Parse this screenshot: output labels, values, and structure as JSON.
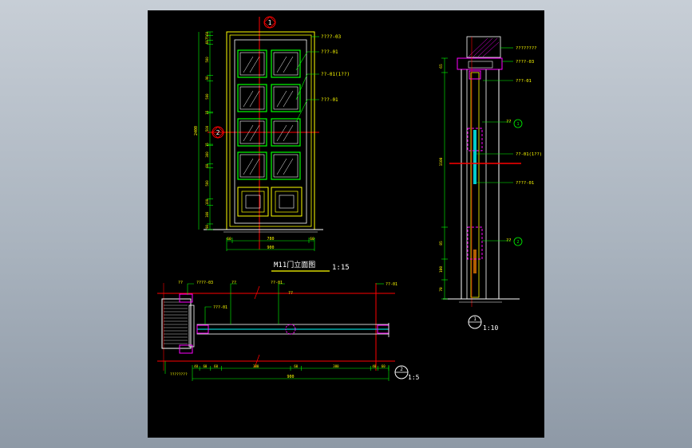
{
  "elevation": {
    "title": "M11门立面图",
    "scale": "1:15",
    "top_marker": "1",
    "side_marker": "2",
    "callouts": [
      "????-03",
      "???-01",
      "??-01(1??)",
      "???-01"
    ],
    "dims_left": [
      "60",
      "75",
      "60",
      "500",
      "90",
      "500",
      "15",
      "500",
      "15",
      "300",
      "60",
      "500",
      "100",
      "300",
      "90"
    ],
    "dim_total_left": "2400",
    "dims_bottom": [
      "60",
      "780",
      "60"
    ],
    "dim_total_bottom": "900"
  },
  "section_v": {
    "marker": "1",
    "scale": "1:10",
    "callouts": [
      "????????",
      "????-03",
      "???-01",
      "??",
      "??-01(1??)",
      "????-01",
      "??"
    ],
    "markers": [
      "1",
      "2"
    ],
    "dims_left": [
      "65",
      "1100",
      "85",
      "100",
      "70"
    ]
  },
  "section_h": {
    "marker": "2",
    "scale": "1:5",
    "callouts": [
      "??",
      "????-03",
      "??",
      "??-01",
      "??",
      "??-01",
      "???-01"
    ],
    "dims_bottom": [
      "40",
      "60",
      "60",
      "380",
      "60",
      "380",
      "40",
      "60"
    ],
    "dim_total": "900",
    "note": "????????"
  },
  "colors": {
    "background": "#000000",
    "frame": "#ffff00",
    "dim": "#00ff00",
    "leader": "#00ff00",
    "glass": "#00ffff",
    "axis": "#ff0000",
    "hardware": "#ff00ff",
    "line": "#ffffff"
  }
}
